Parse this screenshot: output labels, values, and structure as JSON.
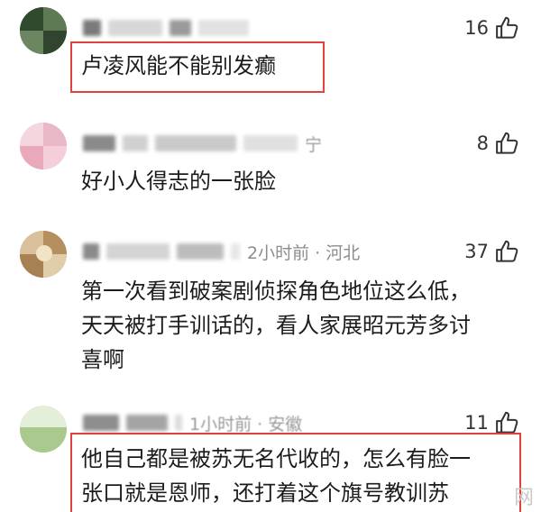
{
  "comments": [
    {
      "likes": "16",
      "text_lines": [
        "卢凌风能不能别发癫"
      ],
      "meta_visible": ""
    },
    {
      "likes": "8",
      "text_lines": [
        "好小人得志的一张脸"
      ],
      "meta_visible": "宁"
    },
    {
      "likes": "37",
      "text_lines": [
        "第一次看到破案剧侦探角色地位这么低，",
        "天天被打手训话的，看人家展昭元芳多讨",
        "喜啊"
      ],
      "meta_visible": "2小时前 · 河北"
    },
    {
      "likes": "11",
      "text_lines": [
        "他自己都是被苏无名代收的，怎么有脸一",
        "张口就是恩师，还打着这个旗号教训苏"
      ],
      "meta_visible": "1小时前 · 安徽"
    }
  ],
  "watermark": "网",
  "colors": {
    "highlight_box": "#e0423f",
    "meta_gray": "#9a9a9a",
    "text": "#1c1c1c"
  },
  "icons": {
    "like": "thumbs-up-icon"
  }
}
